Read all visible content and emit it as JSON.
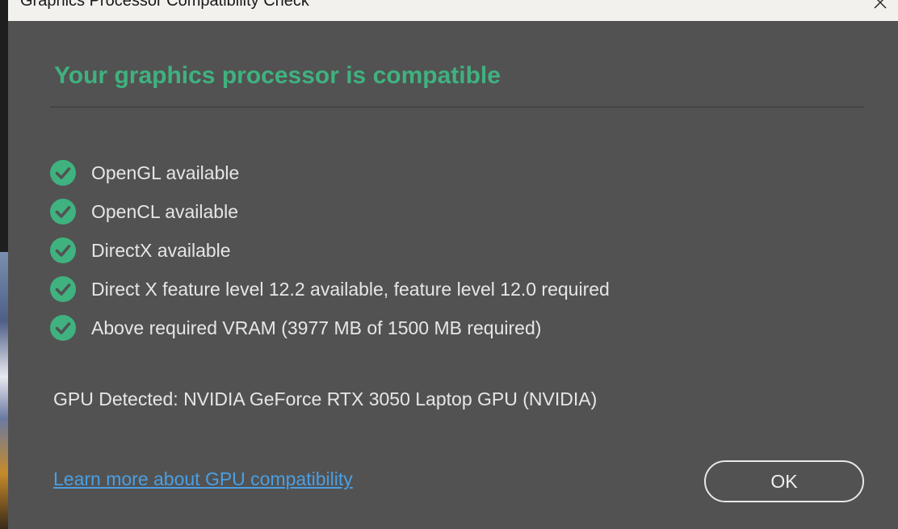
{
  "window": {
    "title": "Graphics Processor Compatibility Check"
  },
  "dialog": {
    "heading": "Your graphics processor is compatible",
    "checks": [
      {
        "label": "OpenGL available",
        "icon": "check-circle-icon",
        "status": "pass"
      },
      {
        "label": "OpenCL available",
        "icon": "check-circle-icon",
        "status": "pass"
      },
      {
        "label": "DirectX available",
        "icon": "check-circle-icon",
        "status": "pass"
      },
      {
        "label": "Direct X feature level 12.2 available, feature level 12.0 required",
        "icon": "check-circle-icon",
        "status": "pass"
      },
      {
        "label": "Above required VRAM (3977 MB of 1500 MB required)",
        "icon": "check-circle-icon",
        "status": "pass"
      }
    ],
    "gpu_detected": "GPU Detected: NVIDIA GeForce RTX 3050 Laptop GPU (NVIDIA)",
    "learn_more_link": "Learn more about GPU compatibility",
    "ok_label": "OK"
  },
  "colors": {
    "accent_green": "#3fb27f",
    "link_blue": "#4a9fe3",
    "dialog_bg": "#525252",
    "titlebar_bg": "#f3f1ee"
  }
}
